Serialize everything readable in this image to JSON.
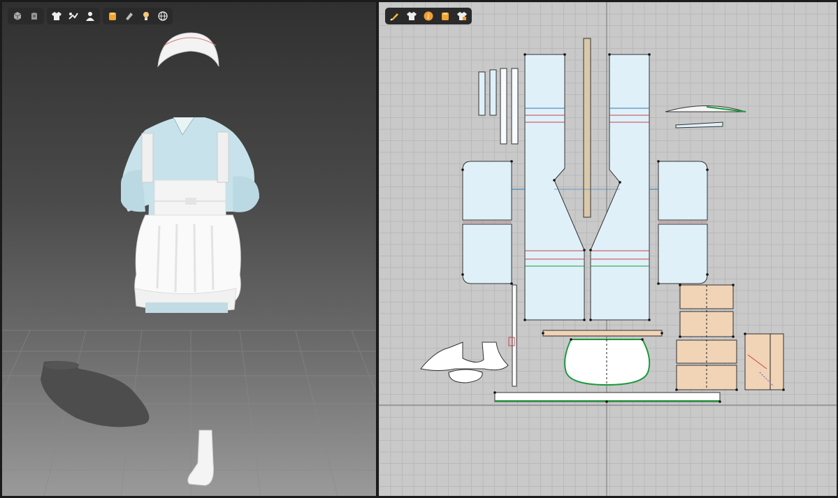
{
  "viewport3d": {
    "toolbar_groups": [
      {
        "icons": [
          "avatar-display-icon",
          "garment-display-icon"
        ]
      },
      {
        "icons": [
          "shirt-icon",
          "texture-icon",
          "user-icon"
        ]
      },
      {
        "icons": [
          "fabric-icon",
          "layer-icon",
          "lighting-icon",
          "globe-icon"
        ]
      }
    ],
    "background_color": "#3a3a3a"
  },
  "viewport2d": {
    "toolbar_icons": [
      "edit-pattern-icon",
      "shirt-icon",
      "info-icon",
      "fabric-icon",
      "lock-shirt-icon"
    ],
    "background_color": "#c9c9c9",
    "pattern_fill": "#dff0f8",
    "panel_fill": "#f1d3b6",
    "strap_fill": "#d9c9aa",
    "seam_red": "#c8424a",
    "seam_green": "#1c9a3c"
  }
}
